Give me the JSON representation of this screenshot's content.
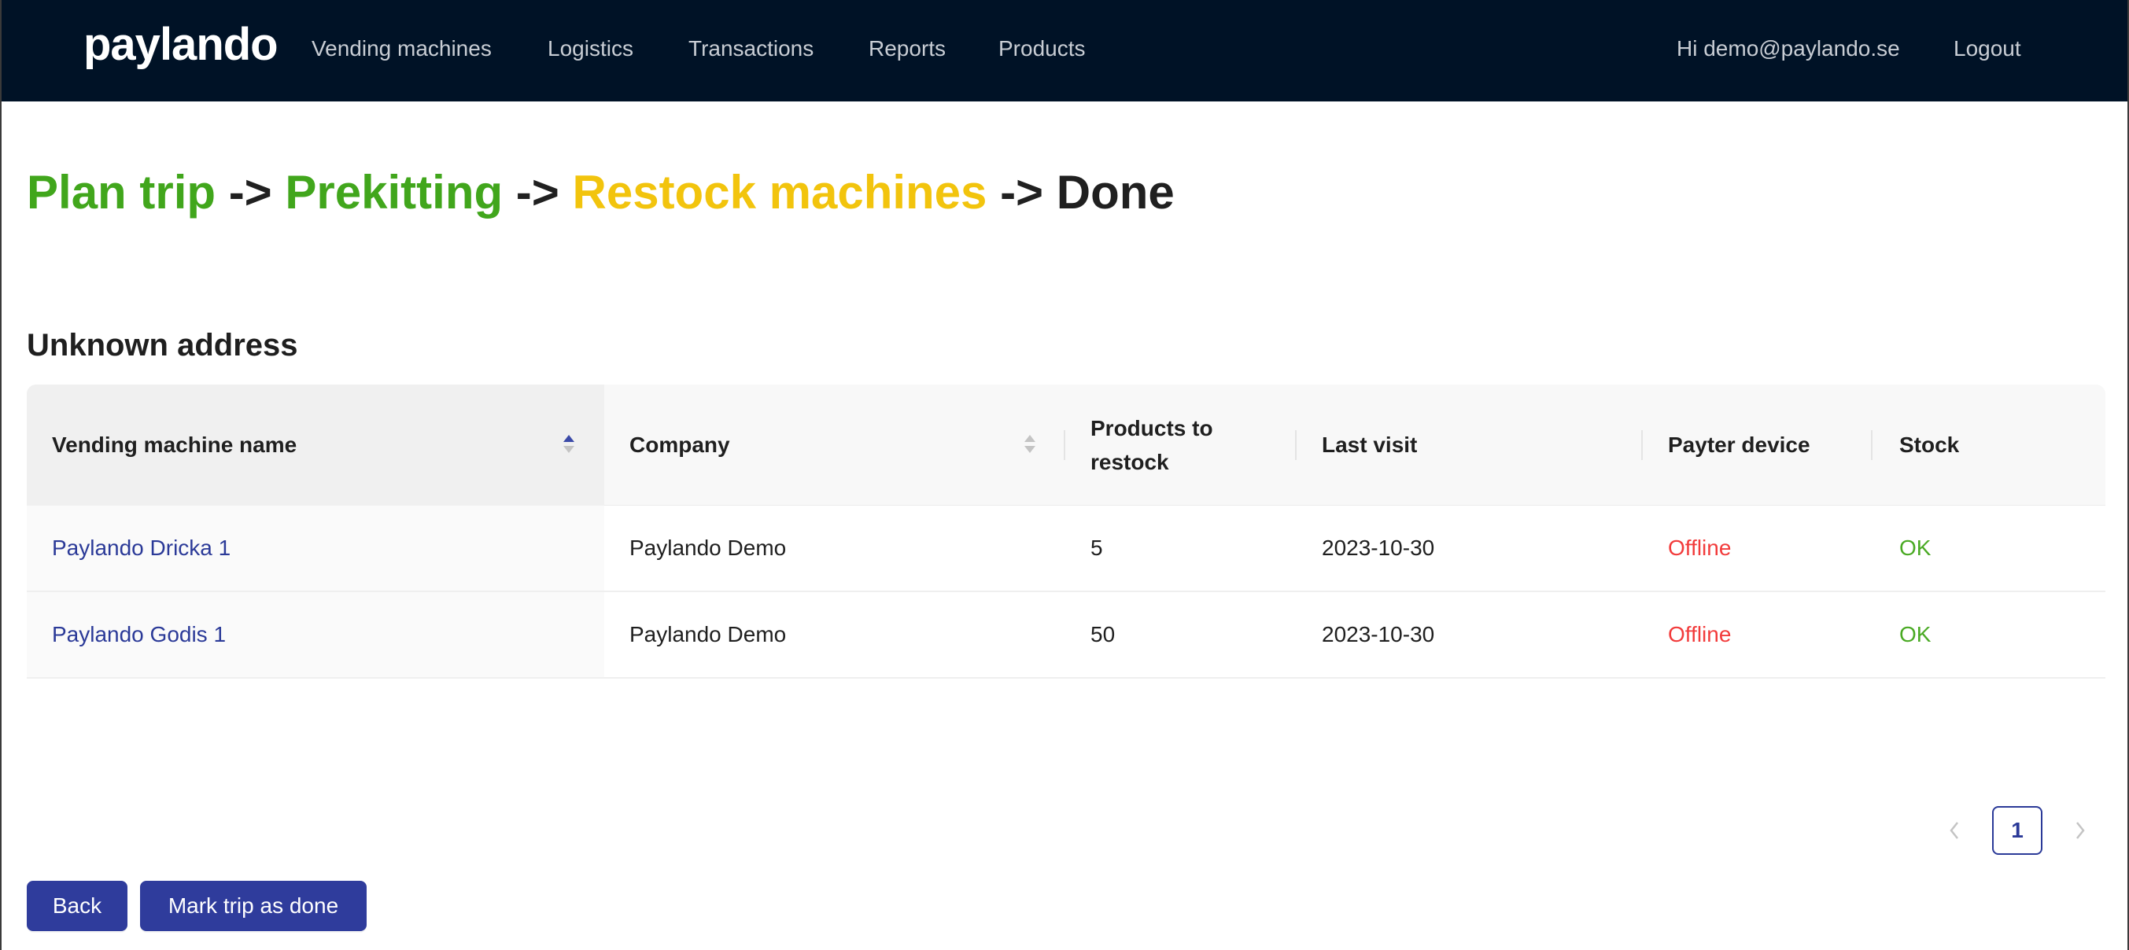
{
  "app": {
    "logo_text": "paylando"
  },
  "nav": {
    "items": [
      {
        "label": "Vending machines"
      },
      {
        "label": "Logistics"
      },
      {
        "label": "Transactions"
      },
      {
        "label": "Reports"
      },
      {
        "label": "Products"
      }
    ],
    "greeting": "Hi demo@paylando.se",
    "logout_label": "Logout"
  },
  "steps": {
    "items": [
      {
        "label": "Plan trip",
        "state": "done"
      },
      {
        "label": "Prekitting",
        "state": "done"
      },
      {
        "label": "Restock machines",
        "state": "current"
      },
      {
        "label": "Done",
        "state": "pending"
      }
    ],
    "separator": "->"
  },
  "section": {
    "title": "Unknown address"
  },
  "table": {
    "columns": [
      {
        "label": "Vending machine name",
        "sortable": true,
        "sort": "ascending"
      },
      {
        "label": "Company",
        "sortable": true,
        "sort": "none"
      },
      {
        "label_lines": [
          "Products to",
          "restock"
        ]
      },
      {
        "label": "Last visit"
      },
      {
        "label": "Payter device"
      },
      {
        "label": "Stock"
      }
    ],
    "rows": [
      {
        "name": "Paylando Dricka 1",
        "company": "Paylando Demo",
        "products_to_restock": "5",
        "last_visit": "2023-10-30",
        "payter_device": "Offline",
        "stock": "OK"
      },
      {
        "name": "Paylando Godis 1",
        "company": "Paylando Demo",
        "products_to_restock": "50",
        "last_visit": "2023-10-30",
        "payter_device": "Offline",
        "stock": "OK"
      }
    ]
  },
  "pagination": {
    "prev_icon": "chevron-left-icon",
    "current_page": "1",
    "next_icon": "chevron-right-icon"
  },
  "actions": {
    "back_label": "Back",
    "done_label": "Mark trip as done"
  },
  "colors": {
    "navbar_bg": "#001226",
    "primary": "#2f3c9c",
    "step_done": "#41a61c",
    "step_current": "#f2c40d",
    "offline": "#f23b3b",
    "ok": "#4aaa24"
  }
}
